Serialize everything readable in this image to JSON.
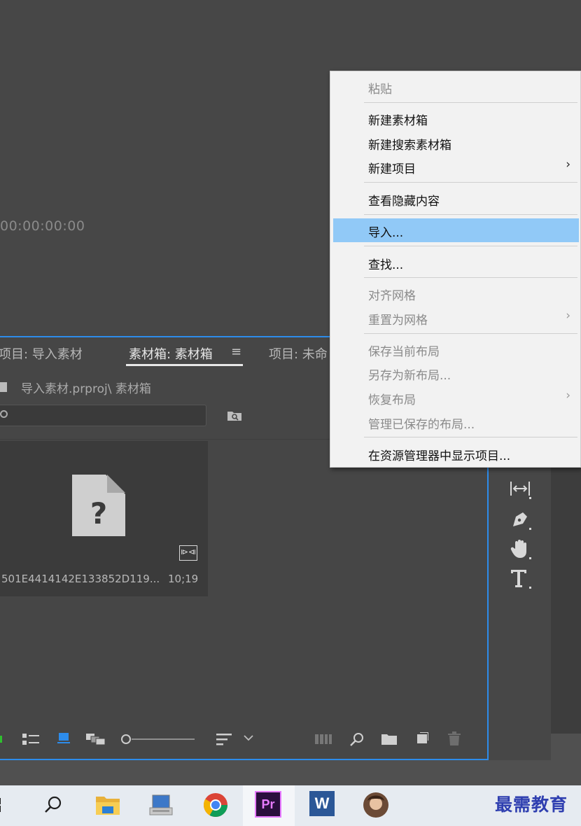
{
  "monitor": {
    "timecode": "00:00:00:00"
  },
  "project_panel": {
    "tabs": [
      {
        "label": "项目: 导入素材"
      },
      {
        "label": "素材箱: 素材箱"
      },
      {
        "label": "项目: 未命"
      }
    ],
    "active_tab_menu": "≡",
    "breadcrumb": "导入素材.prproj\\ 素材箱",
    "clip": {
      "name": "501E4414142E133852D119...",
      "duration": "10;19"
    },
    "audio_badge": "⧐⧏"
  },
  "context_menu": {
    "items": [
      {
        "label": "粘贴",
        "enabled": false
      },
      {
        "label": "新建素材箱",
        "enabled": true
      },
      {
        "label": "新建搜索素材箱",
        "enabled": true
      },
      {
        "label": "新建项目",
        "enabled": true,
        "submenu": true
      },
      {
        "label": "查看隐藏内容",
        "enabled": true
      },
      {
        "label": "导入...",
        "enabled": true,
        "highlighted": true
      },
      {
        "label": "查找...",
        "enabled": true
      },
      {
        "label": "对齐网格",
        "enabled": false
      },
      {
        "label": "重置为网格",
        "enabled": false,
        "submenu": true
      },
      {
        "label": "保存当前布局",
        "enabled": false
      },
      {
        "label": "另存为新布局...",
        "enabled": false
      },
      {
        "label": "恢复布局",
        "enabled": false,
        "submenu": true
      },
      {
        "label": "管理已保存的布局...",
        "enabled": false
      },
      {
        "label": "在资源管理器中显示项目...",
        "enabled": true
      }
    ],
    "submenu_arrow": "›",
    "highlight_color": "#91c9f7"
  },
  "taskbar": {
    "premiere_label": "Pr",
    "word_label": "W",
    "watermark": "最需教育"
  },
  "colors": {
    "accent_blue": "#2d8ceb",
    "panel_bg": "#474747",
    "menu_bg": "#f2f2f2"
  }
}
